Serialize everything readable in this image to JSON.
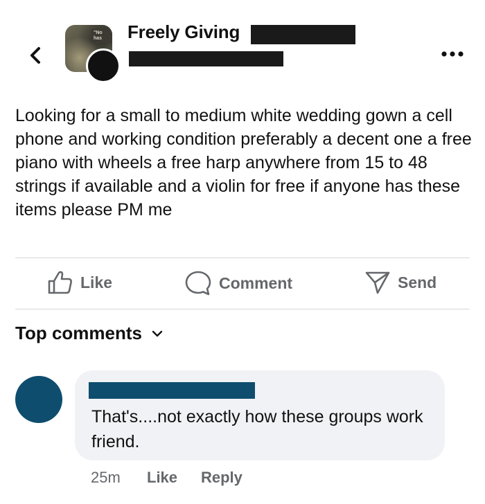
{
  "header": {
    "group_name": "Freely Giving",
    "avatar_sign_text": "\"No has",
    "back_icon": "chevron-left-icon",
    "more_icon": "more-horizontal-icon"
  },
  "post": {
    "text": "Looking for a small to medium white wedding gown a cell phone and working condition preferably a decent one a free piano with wheels a free harp anywhere from 15 to 48 strings if available and a violin for free if anyone has these items please PM me"
  },
  "actions": {
    "like_label": "Like",
    "comment_label": "Comment",
    "send_label": "Send"
  },
  "comments": {
    "heading": "Top comments",
    "items": [
      {
        "text": "That's....not exactly how these groups work friend.",
        "time": "25m",
        "like_label": "Like",
        "reply_label": "Reply"
      }
    ]
  },
  "colors": {
    "redaction_dark": "#1a1a1a",
    "redaction_blue": "#0e4d6e",
    "bubble_bg": "#f0f2f5",
    "muted_text": "#65676b"
  }
}
